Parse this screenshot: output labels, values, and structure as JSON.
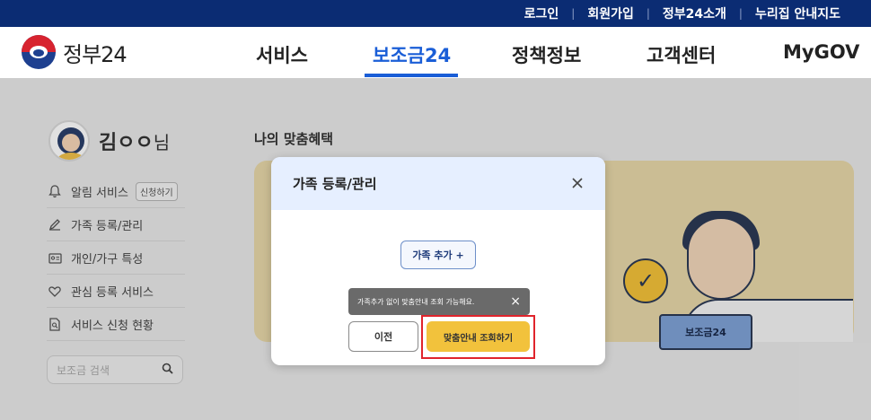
{
  "top_links": [
    "로그인",
    "회원가입",
    "정부24소개",
    "누리집 안내지도"
  ],
  "logo_text": "정부24",
  "nav": [
    "서비스",
    "보조금24",
    "정책정보",
    "고객센터",
    "MyGOV"
  ],
  "profile": {
    "name": "김ㅇㅇ",
    "suffix": "님"
  },
  "side_menu": {
    "alerts": "알림 서비스",
    "alerts_pill": "신청하기",
    "family": "가족 등록/관리",
    "personal": "개인/가구 특성",
    "interest": "관심 등록 서비스",
    "status": "서비스 신청 현황"
  },
  "search": {
    "placeholder": "보조금 검색"
  },
  "section_title": "나의 맞춤혜택",
  "banner": {
    "laptop_label": "보조금24"
  },
  "modal": {
    "title": "가족 등록/관리",
    "add_button": "가족 추가 +",
    "toast": "가족추가 없이 맞춤안내 조회 가능해요.",
    "prev_button": "이전",
    "query_button": "맞춤안내 조회하기"
  },
  "colors": {
    "topbar": "#0b2c73",
    "accent": "#1a5ed7",
    "highlight_border": "#e0242c",
    "query_button": "#f2c23c"
  }
}
